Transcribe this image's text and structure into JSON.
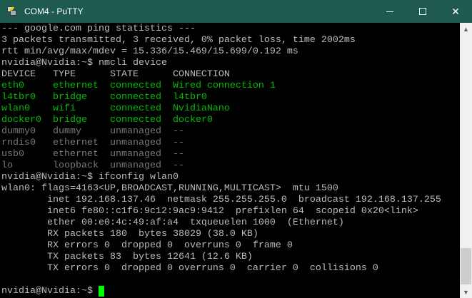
{
  "window": {
    "title": "COM4 - PuTTY",
    "minimize_icon": "minimize-icon",
    "maximize_icon": "maximize-icon",
    "close_icon": "close-icon",
    "close_glyph": "✕"
  },
  "colors": {
    "titlebar": "#1f5a4e",
    "text": "#bbbbbb",
    "green": "#00bb00",
    "dim": "#777777",
    "cursor": "#00ff00"
  },
  "scrollbar": {
    "up": "▲",
    "down": "▼",
    "position_fraction": 0.9
  },
  "lines": [
    [
      {
        "t": "--- google.com ping statistics ---",
        "c": "h"
      }
    ],
    [
      {
        "t": "3 packets transmitted, 3 received, 0% packet loss, time 2002ms",
        "c": "h"
      }
    ],
    [
      {
        "t": "rtt min/avg/max/mdev = 15.336/15.469/15.699/0.192 ms",
        "c": "h"
      }
    ],
    [
      {
        "t": "nvidia@Nvidia:~$ nmcli device",
        "c": "h"
      }
    ],
    [
      {
        "t": "DEVICE   TYPE      STATE      CONNECTION",
        "c": "h"
      }
    ],
    [
      {
        "t": "eth0     ethernet  connected  Wired connection 1",
        "c": "g"
      }
    ],
    [
      {
        "t": "l4tbr0   bridge    connected  l4tbr0",
        "c": "g"
      }
    ],
    [
      {
        "t": "wlan0    wifi      connected  NvidiaNano",
        "c": "g"
      }
    ],
    [
      {
        "t": "docker0  bridge    connected  docker0",
        "c": "g"
      }
    ],
    [
      {
        "t": "dummy0   dummy     unmanaged  --",
        "c": "d"
      }
    ],
    [
      {
        "t": "rndis0   ethernet  unmanaged  --",
        "c": "d"
      }
    ],
    [
      {
        "t": "usb0     ethernet  unmanaged  --",
        "c": "d"
      }
    ],
    [
      {
        "t": "lo       loopback  unmanaged  --",
        "c": "d"
      }
    ],
    [
      {
        "t": "nvidia@Nvidia:~$ ifconfig wlan0",
        "c": "h"
      }
    ],
    [
      {
        "t": "wlan0: flags=4163<UP,BROADCAST,RUNNING,MULTICAST>  mtu 1500",
        "c": "h"
      }
    ],
    [
      {
        "t": "        inet 192.168.137.46  netmask 255.255.255.0  broadcast 192.168.137.255",
        "c": "h"
      }
    ],
    [
      {
        "t": "        inet6 fe80::c1f6:9c12:9ac9:9412  prefixlen 64  scopeid 0x20<link>",
        "c": "h"
      }
    ],
    [
      {
        "t": "        ether 00:e0:4c:49:af:a4  txqueuelen 1000  (Ethernet)",
        "c": "h"
      }
    ],
    [
      {
        "t": "        RX packets 180  bytes 38029 (38.0 KB)",
        "c": "h"
      }
    ],
    [
      {
        "t": "        RX errors 0  dropped 0  overruns 0  frame 0",
        "c": "h"
      }
    ],
    [
      {
        "t": "        TX packets 83  bytes 12641 (12.6 KB)",
        "c": "h"
      }
    ],
    [
      {
        "t": "        TX errors 0  dropped 0 overruns 0  carrier 0  collisions 0",
        "c": "h"
      }
    ],
    [
      {
        "t": "",
        "c": "h"
      }
    ],
    [
      {
        "t": "nvidia@Nvidia:~$ ",
        "c": "h"
      }
    ]
  ]
}
